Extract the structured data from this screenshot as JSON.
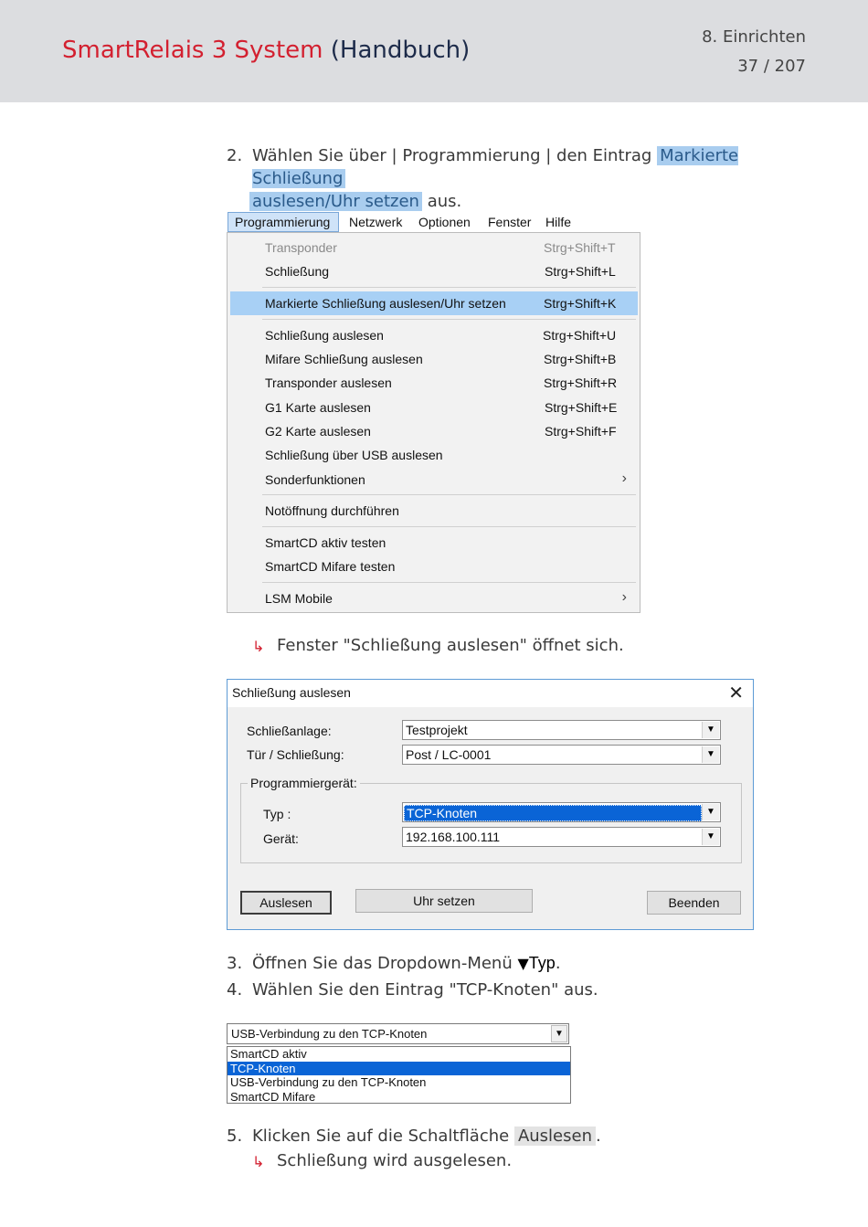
{
  "header": {
    "brand_red": "SmartRelais 3 System",
    "brand_dark": "(Handbuch)",
    "chapter": "8. Einrichten",
    "page": "37 / 207"
  },
  "steps": {
    "s2_num": "2.",
    "s2_text": "Wählen Sie über | Programmierung | den Eintrag",
    "s2_hl_line1": "Markierte Schließung",
    "s2_hl_line2": "auslesen/Uhr setzen",
    "s2_end": "aus.",
    "r1_arrow": "↳",
    "r1_text": "Fenster \"Schließung auslesen\" öffnet sich.",
    "s3_num": "3.",
    "s3_text": "Öffnen Sie das Dropdown-Menü",
    "s3_symbol": "▼",
    "s3_target": "Typ",
    "s3_end": ".",
    "s4_num": "4.",
    "s4_text": "Wählen Sie den Eintrag \"TCP-Knoten\" aus.",
    "s5_num": "5.",
    "s5_text": "Klicken Sie auf die Schaltfläche",
    "s5_button": "Auslesen",
    "s5_end": ".",
    "r2_arrow": "↳",
    "r2_text": "Schließung wird ausgelesen."
  },
  "menu": {
    "bar": [
      "Programmierung",
      "Netzwerk",
      "Optionen",
      "Fenster",
      "Hilfe"
    ],
    "items": [
      {
        "label": "Transponder",
        "shortcut": "Strg+Shift+T"
      },
      {
        "label": "Schließung",
        "shortcut": "Strg+Shift+L"
      },
      {
        "label": "Markierte Schließung auslesen/Uhr setzen",
        "shortcut": "Strg+Shift+K"
      },
      {
        "label": "Schließung auslesen",
        "shortcut": "Strg+Shift+U"
      },
      {
        "label": "Mifare Schließung auslesen",
        "shortcut": "Strg+Shift+B"
      },
      {
        "label": "Transponder auslesen",
        "shortcut": "Strg+Shift+R"
      },
      {
        "label": "G1 Karte auslesen",
        "shortcut": "Strg+Shift+E"
      },
      {
        "label": "G2 Karte auslesen",
        "shortcut": "Strg+Shift+F"
      },
      {
        "label": "Schließung über USB auslesen",
        "shortcut": ""
      },
      {
        "label": "Sonderfunktionen",
        "shortcut": ""
      },
      {
        "label": "Notöffnung durchführen",
        "shortcut": ""
      },
      {
        "label": "SmartCD aktiv testen",
        "shortcut": ""
      },
      {
        "label": "SmartCD Mifare testen",
        "shortcut": ""
      },
      {
        "label": "LSM Mobile",
        "shortcut": ""
      }
    ],
    "submenu_arrow": "›"
  },
  "dialog": {
    "title": "Schließung auslesen",
    "close": "✕",
    "schliessanlage_label": "Schließanlage:",
    "schliessanlage_value": "Testprojekt",
    "tuer_label": "Tür / Schließung:",
    "tuer_value": "Post / LC-0001",
    "group_title": "Programmiergerät:",
    "typ_label": "Typ :",
    "typ_value": "TCP-Knoten",
    "geraet_label": "Gerät:",
    "geraet_value": "192.168.100.111",
    "btn_auslesen": "Auslesen",
    "btn_uhr": "Uhr setzen",
    "btn_beenden": "Beenden",
    "dropdown_symbol": "▼"
  },
  "dropdown": {
    "current": "USB-Verbindung zu den TCP-Knoten",
    "options": [
      "SmartCD aktiv",
      "TCP-Knoten",
      "USB-Verbindung zu den TCP-Knoten",
      "SmartCD Mifare"
    ],
    "selected": "TCP-Knoten",
    "symbol": "▼"
  }
}
